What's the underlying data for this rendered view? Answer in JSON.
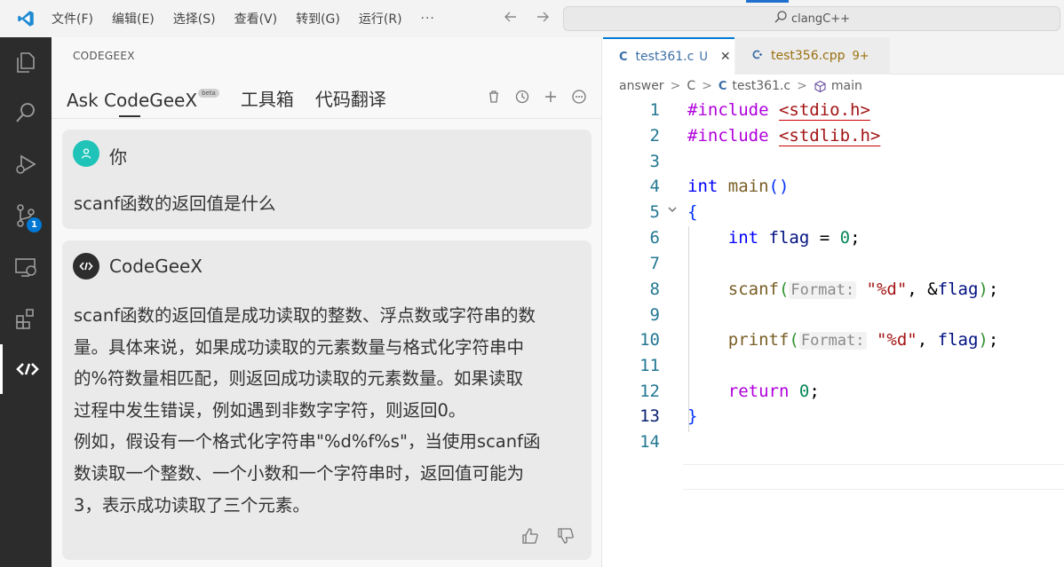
{
  "menu": {
    "items": [
      "文件(F)",
      "编辑(E)",
      "选择(S)",
      "查看(V)",
      "转到(G)",
      "运行(R)"
    ],
    "more": "···"
  },
  "search": {
    "text": "clangC++"
  },
  "activity_bar": {
    "icons": [
      "explorer-icon",
      "search-icon",
      "run-debug-icon",
      "source-control-icon",
      "remote-explorer-icon",
      "extensions-icon",
      "codegeex-icon"
    ],
    "source_control_badge": "1"
  },
  "panel": {
    "header": "CODEGEEX",
    "tabs": [
      {
        "label": "Ask CodeGeeX",
        "badge": "beta"
      },
      {
        "label": "工具箱"
      },
      {
        "label": "代码翻译"
      }
    ],
    "messages": [
      {
        "sender": "你",
        "text": "scanf函数的返回值是什么"
      },
      {
        "sender": "CodeGeeX",
        "lines": [
          "scanf函数的返回值是成功读取的整数、浮点数或字符串的数",
          "量。具体来说，如果成功读取的元素数量与格式化字符串中",
          "的%符数量相匹配，则返回成功读取的元素数量。如果读取",
          "过程中发生错误，例如遇到非数字字符，则返回0。",
          "例如，假设有一个格式化字符串\"%d%f%s\"，当使用scanf函",
          "数读取一个整数、一个小数和一个字符串时，返回值可能为",
          "3，表示成功读取了三个元素。"
        ]
      }
    ]
  },
  "editor": {
    "tabs": [
      {
        "icon": "C",
        "name": "test361.c",
        "status": "U",
        "close": "✕"
      },
      {
        "icon": "C++",
        "name": "test356.cpp",
        "status": "9+"
      }
    ],
    "breadcrumb": {
      "folder1": "answer",
      "folder2": "C",
      "file_icon": "C",
      "file": "test361.c",
      "symbol": "main",
      "sep": ">"
    },
    "line_numbers": [
      "1",
      "2",
      "3",
      "4",
      "5",
      "6",
      "7",
      "8",
      "9",
      "10",
      "11",
      "12",
      "13",
      "14"
    ],
    "code": {
      "l1_pre": "#include",
      "l1_inc": "<stdio.h>",
      "l2_pre": "#include",
      "l2_inc": "<stdlib.h>",
      "l4_type": "int",
      "l4_fn": "main",
      "l4_paren": "()",
      "l5_brace": "{",
      "l6_type": "int",
      "l6_var": "flag",
      "l6_op": " = ",
      "l6_num": "0",
      "l6_end": ";",
      "l8_fn": "scanf",
      "l8_open": "(",
      "l8_hint": "Format:",
      "l8_str": "\"%d\"",
      "l8_mid": ", &",
      "l8_var": "flag",
      "l8_close": ")",
      "l8_end": ";",
      "l10_fn": "printf",
      "l10_open": "(",
      "l10_hint": "Format:",
      "l10_str": "\"%d\"",
      "l10_mid": ", ",
      "l10_var": "flag",
      "l10_close": ")",
      "l10_end": ";",
      "l12_ctl": "return",
      "l12_num": "0",
      "l12_end": ";",
      "l13_brace": "}"
    }
  },
  "colors": {
    "activity_bg": "#2c2c2c",
    "accent": "#0078d4",
    "user_avatar": "#20c3b8",
    "card_bg": "#eaeaea"
  }
}
